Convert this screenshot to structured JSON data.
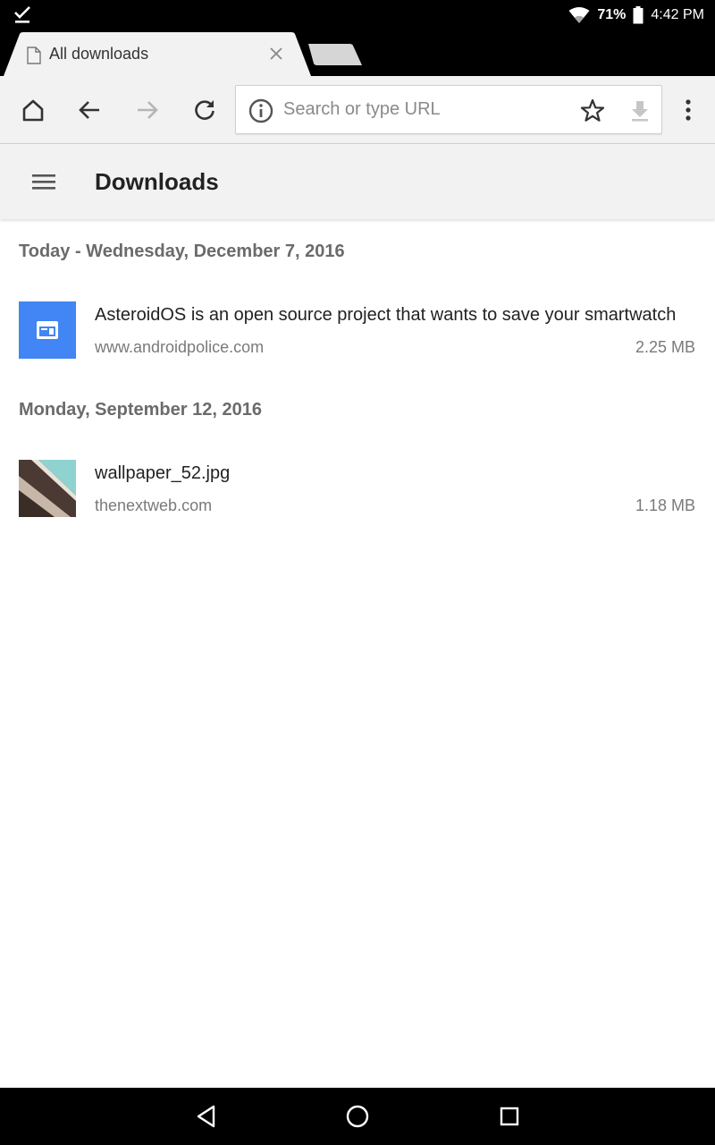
{
  "status_bar": {
    "battery_percent": "71%",
    "time": "4:42 PM",
    "notification_icon": "download-done-icon",
    "wifi_icon": "wifi-icon",
    "battery_icon": "battery-icon"
  },
  "tabs": {
    "active_title": "All downloads"
  },
  "toolbar": {
    "omnibox_placeholder": "Search or type URL"
  },
  "downloads": {
    "title": "Downloads",
    "sections": [
      {
        "date": "Today - Wednesday, December 7, 2016",
        "items": [
          {
            "title": "AsteroidOS is an open source project that wants to save your smartwatch",
            "source": "www.androidpolice.com",
            "size": "2.25 MB",
            "thumb_icon": "web-page-icon"
          }
        ]
      },
      {
        "date": "Monday, September 12, 2016",
        "items": [
          {
            "title": "wallpaper_52.jpg",
            "source": "thenextweb.com",
            "size": "1.18 MB",
            "thumb_icon": "image-thumbnail"
          }
        ]
      }
    ]
  },
  "colors": {
    "accent_blue": "#4285f4",
    "toolbar_bg": "#f2f2f2",
    "text_primary": "#222222",
    "text_secondary": "#7a7a7a"
  }
}
